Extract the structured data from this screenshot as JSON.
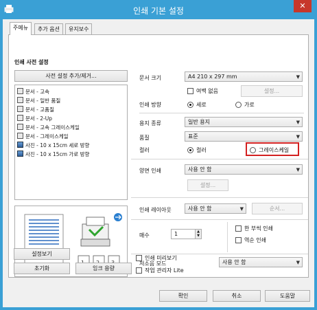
{
  "window": {
    "title": "인쇄 기본 설정",
    "close_label": "✕"
  },
  "tabs": [
    {
      "label": "주메뉴",
      "active": true
    },
    {
      "label": "추가 옵션",
      "active": false
    },
    {
      "label": "유지보수",
      "active": false
    }
  ],
  "left": {
    "presets_heading": "인쇄 사전 설정",
    "presets_button": "사전 설정 추가/제거...",
    "presets": [
      {
        "label": "문서 - 고속",
        "icon": "document-icon"
      },
      {
        "label": "문서 - 일반 품질",
        "icon": "document-icon"
      },
      {
        "label": "문서 - 고품질",
        "icon": "document-icon"
      },
      {
        "label": "문서 - 2-Up",
        "icon": "two-up-icon"
      },
      {
        "label": "문서 - 고속 그레이스케일",
        "icon": "document-icon"
      },
      {
        "label": "문서 - 그레이스케일",
        "icon": "document-icon"
      },
      {
        "label": "사진 - 10 x 15cm 세로 방향",
        "icon": "photo-icon"
      },
      {
        "label": "사진 - 10 x 15cm 가로 방향",
        "icon": "photo-icon"
      }
    ],
    "show_settings_button": "설정보기",
    "reset_button": "초기화",
    "ink_levels_button": "잉크 용량"
  },
  "right": {
    "paper_size_label": "문서 크기",
    "paper_size_value": "A4 210 x 297 mm",
    "borderless_label": "여백 없음",
    "borderless_settings_button": "설정...",
    "orientation_label": "인쇄 방향",
    "orientation_portrait": "세로",
    "orientation_landscape": "가로",
    "paper_type_label": "용지 종류",
    "paper_type_value": "일반 용지",
    "quality_label": "품질",
    "quality_value": "표준",
    "color_label": "컬러",
    "color_option": "컬러",
    "grayscale_option": "그레이스케일",
    "duplex_label": "양면 인쇄",
    "duplex_value": "사용 안 함",
    "duplex_settings_button": "설정...",
    "multipage_label": "인쇄 레이아웃",
    "multipage_value": "사용 안 함",
    "multipage_order_button": "순서...",
    "copies_label": "매수",
    "copies_value": "1",
    "reverse_order_label": "한 부씩 인쇄",
    "collate_label": "역순 인쇄",
    "quiet_mode_label": "저소음 모드",
    "quiet_mode_value": "사용 안 함",
    "print_preview_label": "인쇄 미리보기",
    "job_arranger_label": "작업 관리자 Lite"
  },
  "footer": {
    "ok_button": "확인",
    "cancel_button": "취소",
    "help_button": "도움말"
  },
  "colors": {
    "titlebar": "#3aa0d5",
    "close_button": "#c7372b",
    "highlight": "#d32020"
  }
}
